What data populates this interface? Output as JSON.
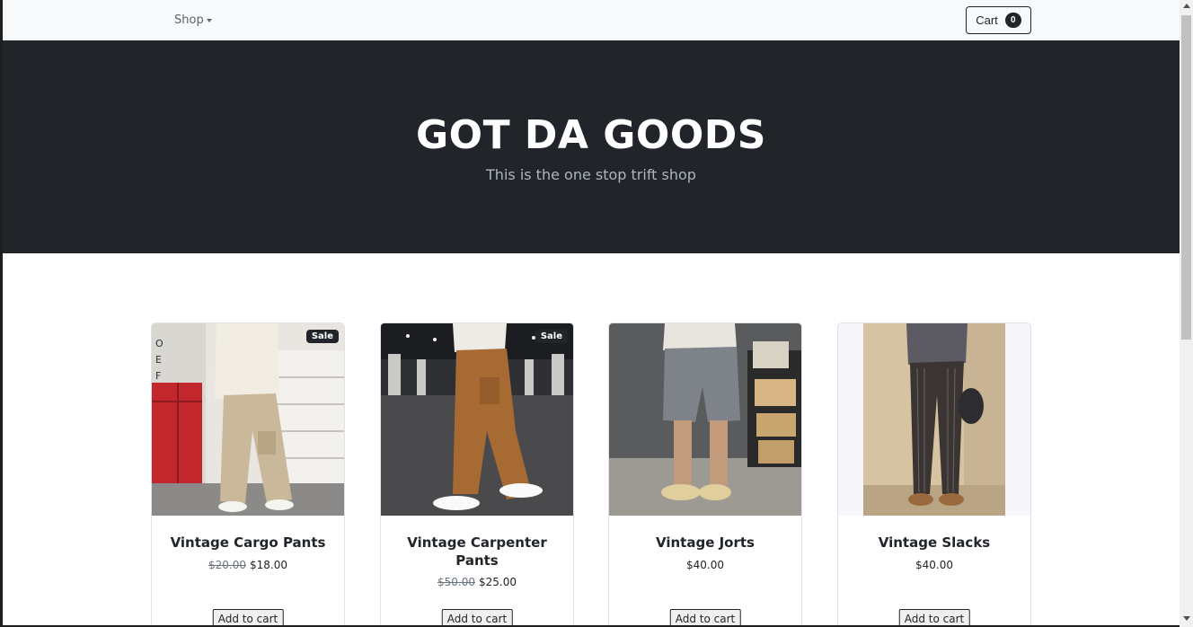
{
  "nav": {
    "shop_label": "Shop",
    "cart_label": "Cart",
    "cart_count": "0"
  },
  "hero": {
    "title": "GOT DA GOODS",
    "subtitle": "This is the one stop trift shop"
  },
  "products": [
    {
      "name": "Vintage Cargo Pants",
      "badge": "Sale",
      "old_price": "$20.00",
      "price": "$18.00",
      "button": "Add to cart",
      "image": "photo-cargo-pants"
    },
    {
      "name": "Vintage Carpenter Pants",
      "badge": "Sale",
      "old_price": "$50.00",
      "price": "$25.00",
      "button": "Add to cart",
      "image": "photo-carpenter-pants"
    },
    {
      "name": "Vintage Jorts",
      "price": "$40.00",
      "button": "Add to cart",
      "image": "photo-jorts"
    },
    {
      "name": "Vintage Slacks",
      "price": "$40.00",
      "button": "Add to cart",
      "image": "photo-slacks"
    }
  ],
  "colors": {
    "hero_bg": "#212529",
    "navbar_bg": "#f8f9fa",
    "text_dark": "#212529",
    "text_muted": "#6c757d"
  }
}
